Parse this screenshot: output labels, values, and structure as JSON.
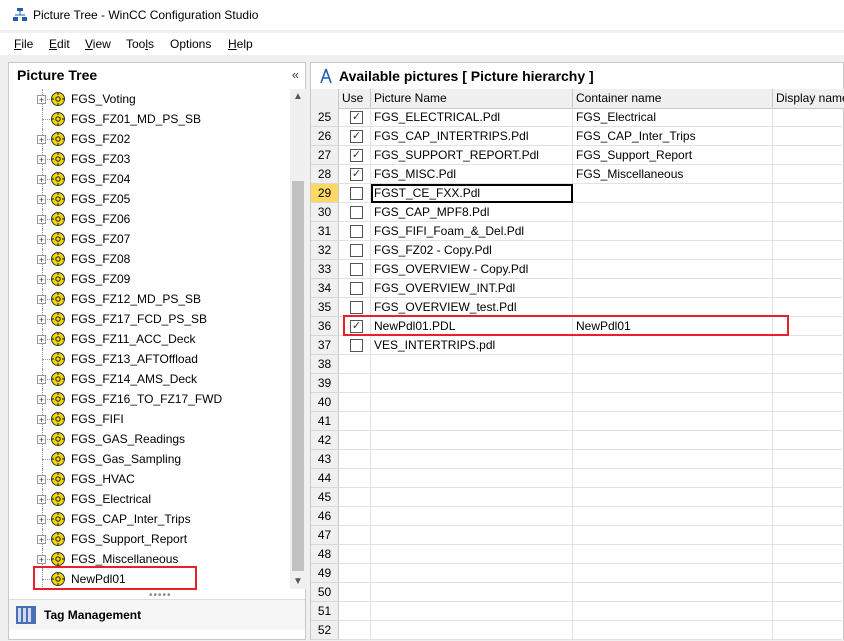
{
  "window": {
    "title": "Picture Tree - WinCC Configuration Studio"
  },
  "menu": [
    {
      "u": "F",
      "rest": "ile"
    },
    {
      "u": "E",
      "rest": "dit"
    },
    {
      "u": "V",
      "rest": "iew"
    },
    {
      "pre": "Too",
      "u": "l",
      "rest": "s"
    },
    {
      "u": "",
      "rest": "Options"
    },
    {
      "u": "H",
      "rest": "elp"
    }
  ],
  "left_pane": {
    "title": "Picture Tree",
    "collapse_glyph": "«",
    "items": [
      {
        "label": "FGS_Voting",
        "expandable": true
      },
      {
        "label": "FGS_FZ01_MD_PS_SB",
        "expandable": false
      },
      {
        "label": "FGS_FZ02",
        "expandable": true
      },
      {
        "label": "FGS_FZ03",
        "expandable": true
      },
      {
        "label": "FGS_FZ04",
        "expandable": true
      },
      {
        "label": "FGS_FZ05",
        "expandable": true
      },
      {
        "label": "FGS_FZ06",
        "expandable": true
      },
      {
        "label": "FGS_FZ07",
        "expandable": true
      },
      {
        "label": "FGS_FZ08",
        "expandable": true
      },
      {
        "label": "FGS_FZ09",
        "expandable": true
      },
      {
        "label": "FGS_FZ12_MD_PS_SB",
        "expandable": true
      },
      {
        "label": "FGS_FZ17_FCD_PS_SB",
        "expandable": true
      },
      {
        "label": "FGS_FZ11_ACC_Deck",
        "expandable": true
      },
      {
        "label": "FGS_FZ13_AFTOffload",
        "expandable": false
      },
      {
        "label": "FGS_FZ14_AMS_Deck",
        "expandable": true
      },
      {
        "label": "FGS_FZ16_TO_FZ17_FWD",
        "expandable": true
      },
      {
        "label": "FGS_FIFI",
        "expandable": true
      },
      {
        "label": "FGS_GAS_Readings",
        "expandable": true
      },
      {
        "label": "FGS_Gas_Sampling",
        "expandable": false
      },
      {
        "label": "FGS_HVAC",
        "expandable": true
      },
      {
        "label": "FGS_Electrical",
        "expandable": true
      },
      {
        "label": "FGS_CAP_Inter_Trips",
        "expandable": true
      },
      {
        "label": "FGS_Support_Report",
        "expandable": true
      },
      {
        "label": "FGS_Miscellaneous",
        "expandable": true
      },
      {
        "label": "NewPdl01",
        "expandable": false
      }
    ],
    "grip": "•••••",
    "tag_management_label": "Tag Management"
  },
  "right_pane": {
    "title": "Available pictures [ Picture hierarchy ]",
    "columns": [
      "Use",
      "Picture Name",
      "Container name",
      "Display name"
    ],
    "rows": [
      {
        "num": "25",
        "checked": true,
        "name": "FGS_ELECTRICAL.Pdl",
        "container": "FGS_Electrical"
      },
      {
        "num": "26",
        "checked": true,
        "name": "FGS_CAP_INTERTRIPS.Pdl",
        "container": "FGS_CAP_Inter_Trips"
      },
      {
        "num": "27",
        "checked": true,
        "name": "FGS_SUPPORT_REPORT.Pdl",
        "container": "FGS_Support_Report"
      },
      {
        "num": "28",
        "checked": true,
        "name": "FGS_MISC.Pdl",
        "container": "FGS_Miscellaneous"
      },
      {
        "num": "29",
        "checked": false,
        "name": "FGST_CE_FXX.Pdl",
        "container": ""
      },
      {
        "num": "30",
        "checked": false,
        "name": "FGS_CAP_MPF8.Pdl",
        "container": ""
      },
      {
        "num": "31",
        "checked": false,
        "name": "FGS_FIFI_Foam_&_Del.Pdl",
        "container": ""
      },
      {
        "num": "32",
        "checked": false,
        "name": "FGS_FZ02 - Copy.Pdl",
        "container": ""
      },
      {
        "num": "33",
        "checked": false,
        "name": "FGS_OVERVIEW - Copy.Pdl",
        "container": ""
      },
      {
        "num": "34",
        "checked": false,
        "name": "FGS_OVERVIEW_INT.Pdl",
        "container": ""
      },
      {
        "num": "35",
        "checked": false,
        "name": "FGS_OVERVIEW_test.Pdl",
        "container": ""
      },
      {
        "num": "36",
        "checked": true,
        "name": "NewPdl01.PDL",
        "container": "NewPdl01"
      },
      {
        "num": "37",
        "checked": false,
        "name": "VES_INTERTRIPS.pdl",
        "container": ""
      },
      {
        "num": "38",
        "checked": null,
        "name": "",
        "container": ""
      },
      {
        "num": "39",
        "checked": null,
        "name": "",
        "container": ""
      },
      {
        "num": "40",
        "checked": null,
        "name": "",
        "container": ""
      },
      {
        "num": "41",
        "checked": null,
        "name": "",
        "container": ""
      },
      {
        "num": "42",
        "checked": null,
        "name": "",
        "container": ""
      },
      {
        "num": "43",
        "checked": null,
        "name": "",
        "container": ""
      },
      {
        "num": "44",
        "checked": null,
        "name": "",
        "container": ""
      },
      {
        "num": "45",
        "checked": null,
        "name": "",
        "container": ""
      },
      {
        "num": "46",
        "checked": null,
        "name": "",
        "container": ""
      },
      {
        "num": "47",
        "checked": null,
        "name": "",
        "container": ""
      },
      {
        "num": "48",
        "checked": null,
        "name": "",
        "container": ""
      },
      {
        "num": "49",
        "checked": null,
        "name": "",
        "container": ""
      },
      {
        "num": "50",
        "checked": null,
        "name": "",
        "container": ""
      },
      {
        "num": "51",
        "checked": null,
        "name": "",
        "container": ""
      },
      {
        "num": "52",
        "checked": null,
        "name": "",
        "container": ""
      }
    ]
  },
  "colors": {
    "highlight_red": "#e8202a",
    "selected_row": "#ffd864",
    "icon_yellow": "#f5d800"
  }
}
